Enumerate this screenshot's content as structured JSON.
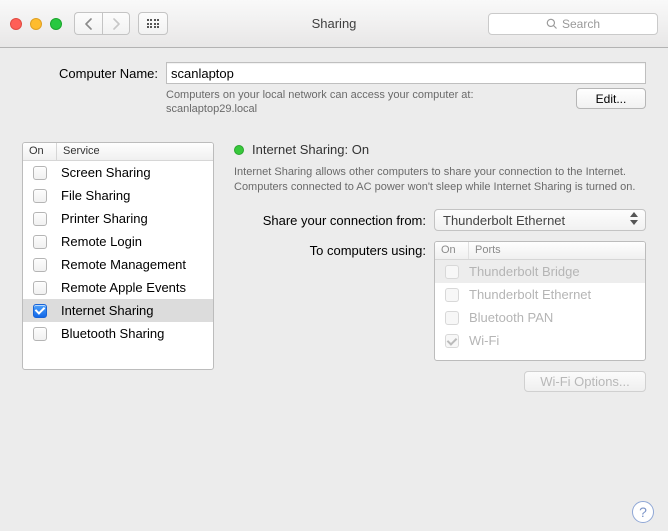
{
  "titlebar": {
    "title": "Sharing",
    "search_placeholder": "Search"
  },
  "computer": {
    "label": "Computer Name:",
    "value": "scanlaptop",
    "subtext": "Computers on your local network can access your computer at: scanlaptop29.local",
    "edit_label": "Edit..."
  },
  "columns": {
    "on": "On",
    "service": "Service",
    "ports": "Ports"
  },
  "services": [
    {
      "label": "Screen Sharing",
      "checked": false
    },
    {
      "label": "File Sharing",
      "checked": false
    },
    {
      "label": "Printer Sharing",
      "checked": false
    },
    {
      "label": "Remote Login",
      "checked": false
    },
    {
      "label": "Remote Management",
      "checked": false
    },
    {
      "label": "Remote Apple Events",
      "checked": false
    },
    {
      "label": "Internet Sharing",
      "checked": true,
      "selected": true
    },
    {
      "label": "Bluetooth Sharing",
      "checked": false
    }
  ],
  "detail": {
    "status_title": "Internet Sharing: On",
    "description": "Internet Sharing allows other computers to share your connection to the Internet. Computers connected to AC power won't sleep while Internet Sharing is turned on.",
    "share_from_label": "Share your connection from:",
    "share_from_value": "Thunderbolt Ethernet",
    "to_label": "To computers using:",
    "ports": [
      {
        "label": "Thunderbolt Bridge",
        "checked": false,
        "selected": true
      },
      {
        "label": "Thunderbolt Ethernet",
        "checked": false
      },
      {
        "label": "Bluetooth PAN",
        "checked": false
      },
      {
        "label": "Wi-Fi",
        "checked": true
      }
    ],
    "wifi_options_label": "Wi-Fi Options..."
  }
}
